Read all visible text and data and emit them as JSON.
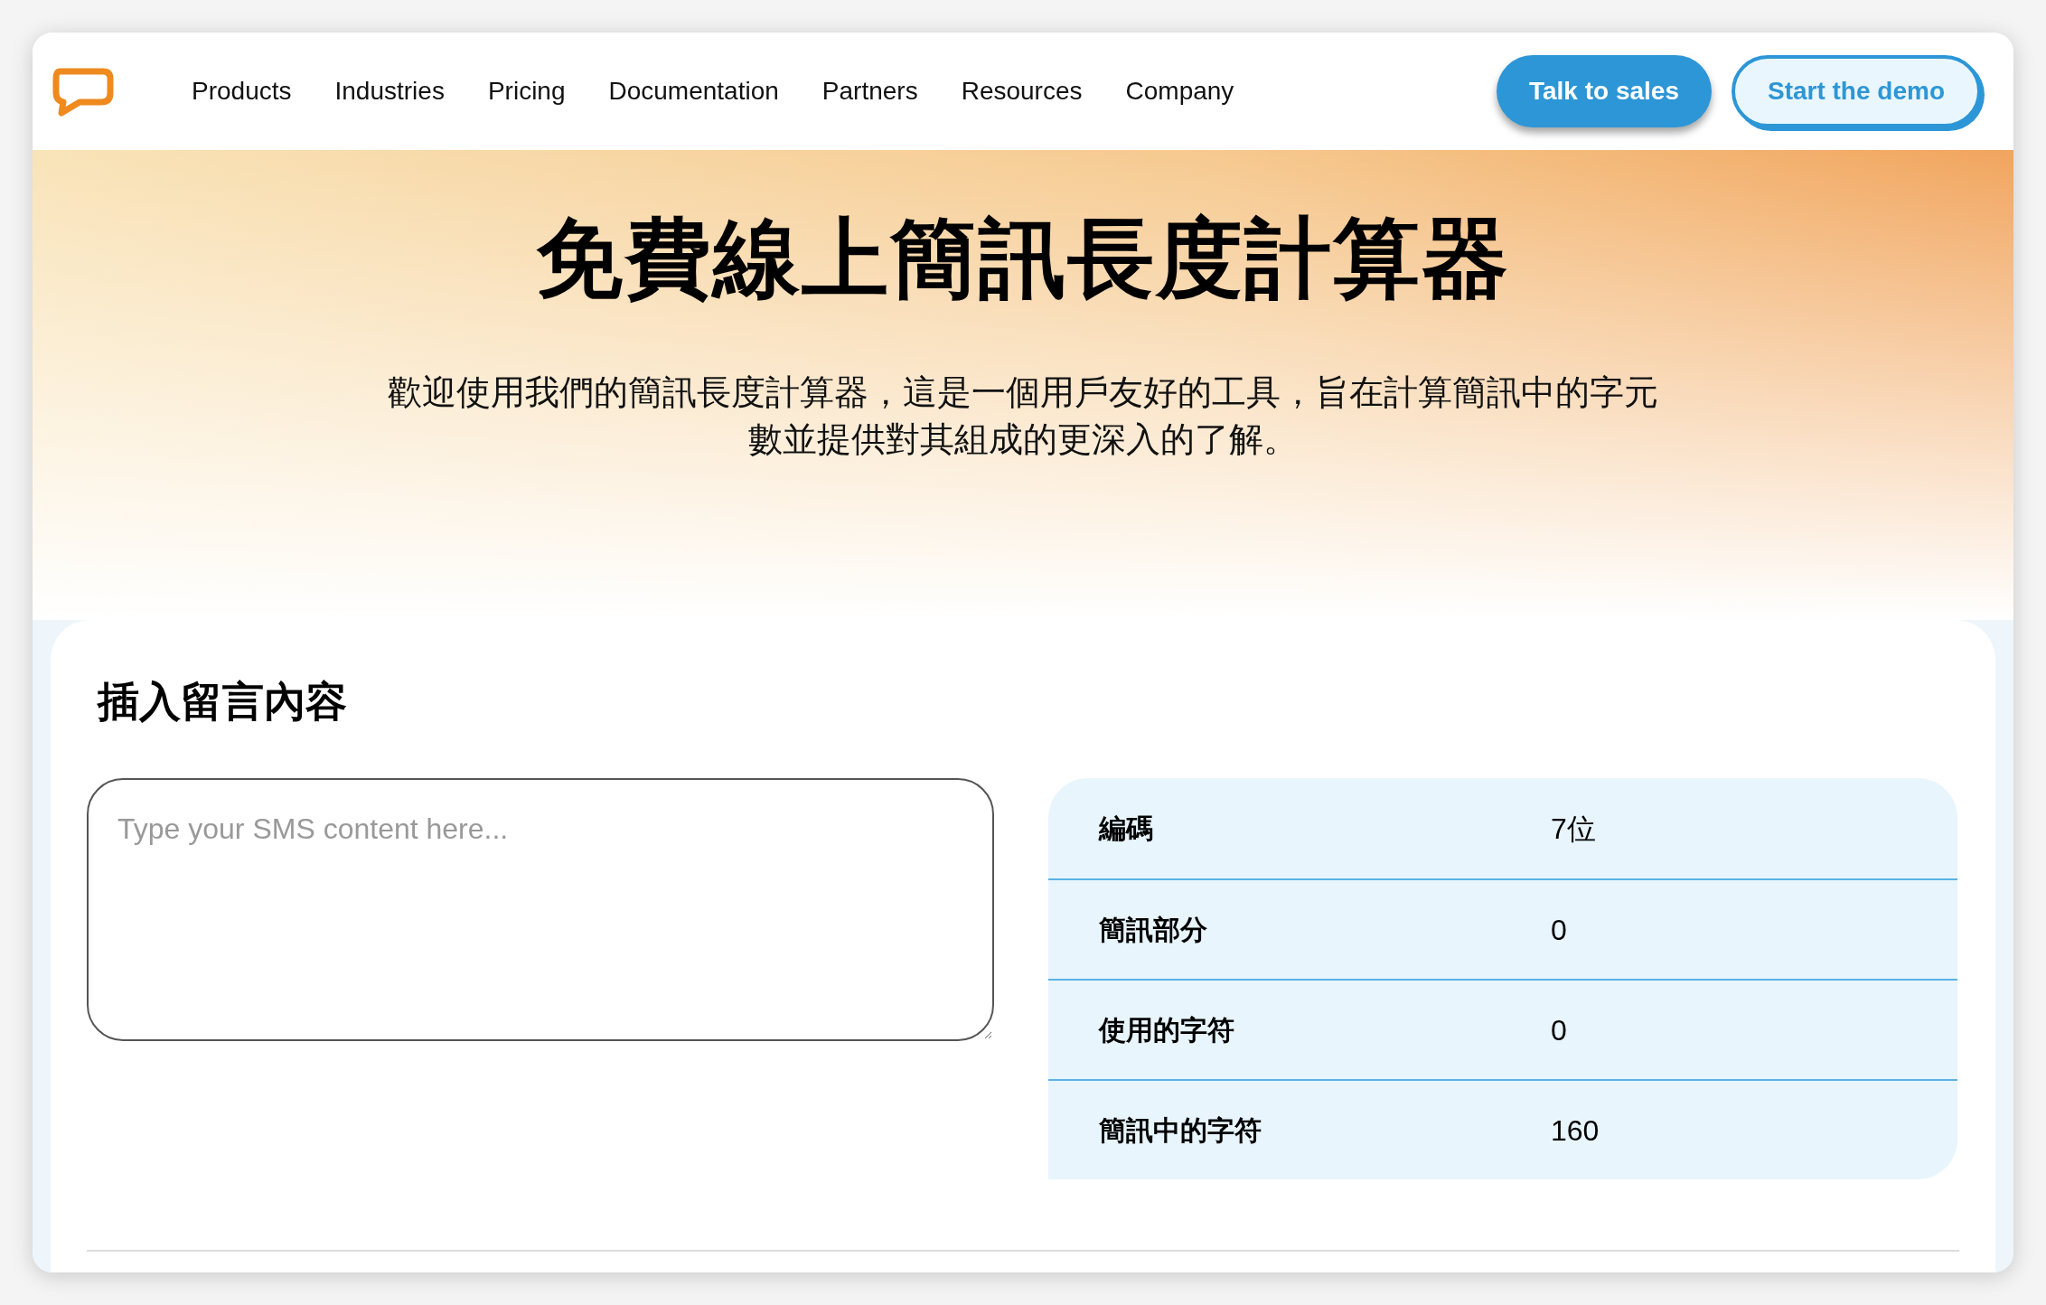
{
  "nav": {
    "items": [
      "Products",
      "Industries",
      "Pricing",
      "Documentation",
      "Partners",
      "Resources",
      "Company"
    ],
    "buttons": [
      {
        "label": "Talk to sales",
        "kind": "primary"
      },
      {
        "label": "Start the demo",
        "kind": "outline"
      }
    ]
  },
  "hero": {
    "title": "免費線上簡訊長度計算器",
    "description": "歡迎使用我們的簡訊長度計算器，這是一個用戶友好的工具，旨在計算簡訊中的字元數並提供對其組成的更深入的了解。"
  },
  "calculator": {
    "heading": "插入留言內容",
    "input": {
      "placeholder": "Type your SMS content here..."
    },
    "stats": [
      {
        "label": "編碼",
        "value": "7位"
      },
      {
        "label": "簡訊部分",
        "value": "0"
      },
      {
        "label": "使用的字符",
        "value": "0"
      },
      {
        "label": "簡訊中的字符",
        "value": "160"
      }
    ]
  }
}
